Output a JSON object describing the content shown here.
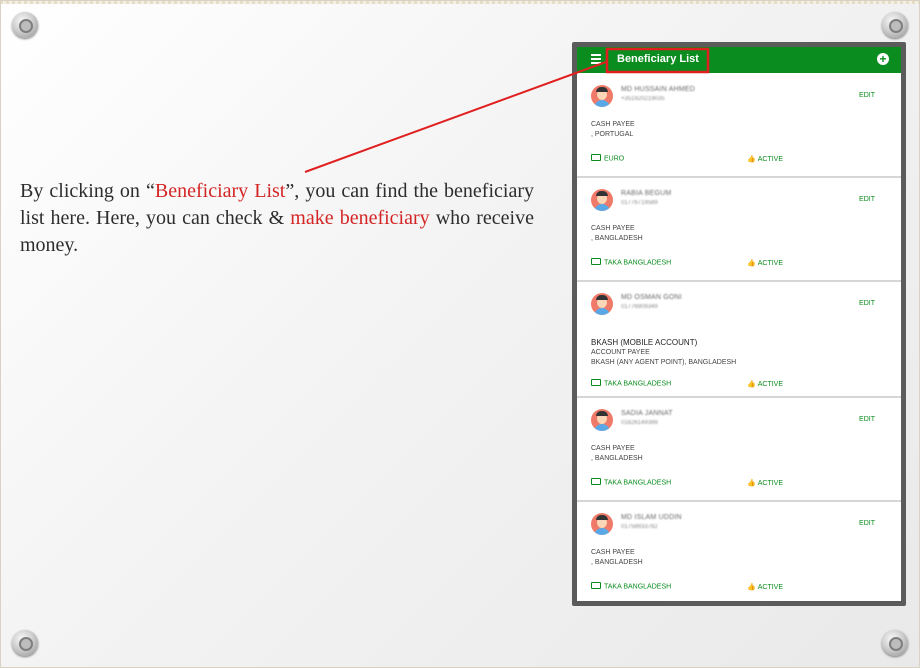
{
  "slide": {
    "description_parts": {
      "p1": "By clicking on “",
      "h1": "Beneficiary List",
      "p2": "”, you can find the beneficiary list here. Here, you can check & ",
      "h2": "make beneficiary",
      "p3": " who receive money."
    }
  },
  "app": {
    "title": "Beneficiary List",
    "menu_icon": "menu-icon",
    "add_icon": "add-circle-icon",
    "add_glyph": "+",
    "colors": {
      "primary": "#0a8c1e",
      "annotation": "#e02020"
    }
  },
  "beneficiaries": [
    {
      "name": "MD HUSSAIN AHMED",
      "phone": "+351920219035",
      "bank": "",
      "payee_type": "CASH PAYEE",
      "country": ", PORTUGAL",
      "currency": "EURO",
      "status": "ACTIVE",
      "edit": "EDIT"
    },
    {
      "name": "RABIA BEGUM",
      "phone": "01776719589",
      "bank": "",
      "payee_type": "CASH PAYEE",
      "country": ", BANGLADESH",
      "currency": "TAKA BANGLADESH",
      "status": "ACTIVE",
      "edit": "EDIT"
    },
    {
      "name": "MD OSMAN GONI",
      "phone": "01776909349",
      "bank": "BKASH (MOBILE ACCOUNT)",
      "payee_type": "ACCOUNT PAYEE",
      "country": "BKASH (ANY AGENT POINT), BANGLADESH",
      "currency": "TAKA BANGLADESH",
      "status": "ACTIVE",
      "edit": "EDIT"
    },
    {
      "name": "SADIA JANNAT",
      "phone": "01826149399",
      "bank": "",
      "payee_type": "CASH PAYEE",
      "country": ", BANGLADESH",
      "currency": "TAKA BANGLADESH",
      "status": "ACTIVE",
      "edit": "EDIT"
    },
    {
      "name": "MD ISLAM UDDIN",
      "phone": "01758933782",
      "bank": "",
      "payee_type": "CASH PAYEE",
      "country": ", BANGLADESH",
      "currency": "TAKA BANGLADESH",
      "status": "ACTIVE",
      "edit": "EDIT"
    }
  ]
}
